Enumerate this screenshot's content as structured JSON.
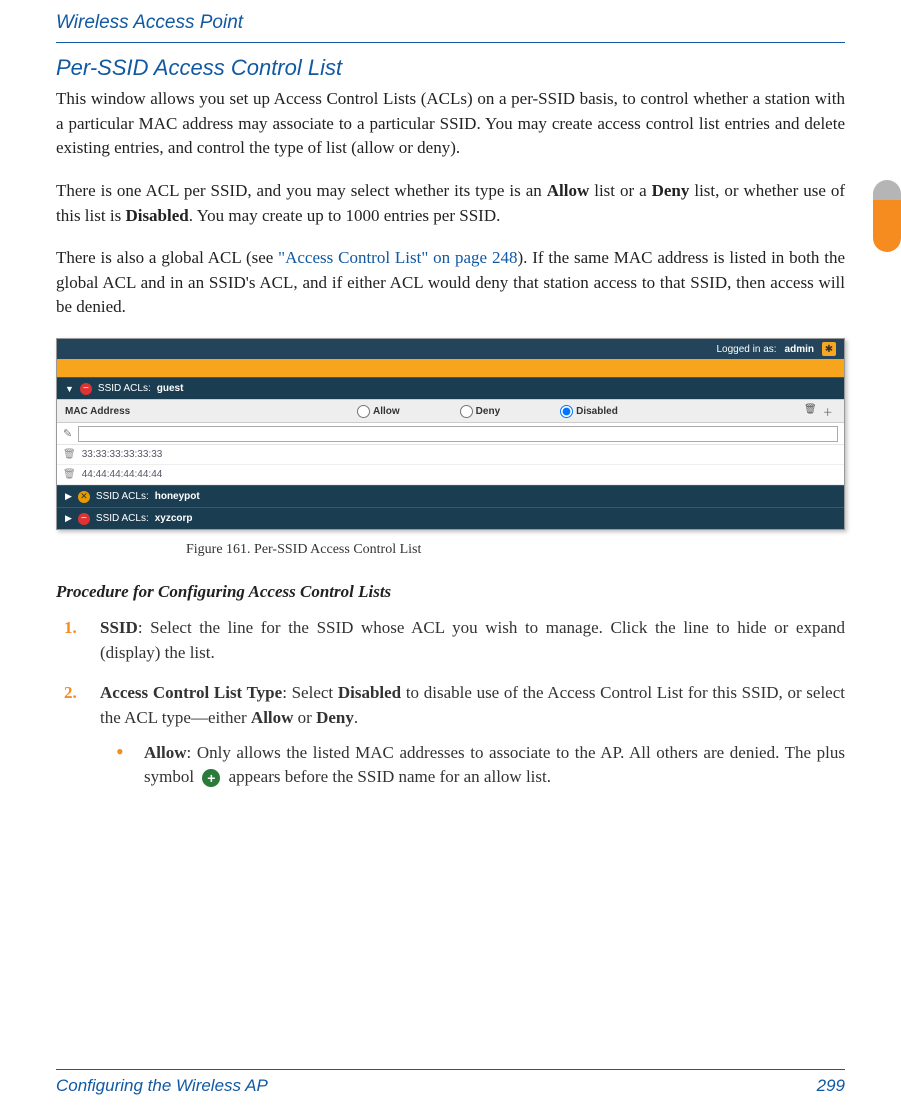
{
  "header": {
    "title": "Wireless Access Point"
  },
  "section": {
    "title": "Per-SSID Access Control List",
    "para1_a": "This window allows you set up Access Control Lists (ACLs) on a per-SSID basis, to control whether a station with a particular MAC address may associate to a particular SSID. You may create access control list entries and delete existing entries, and control the type of list (allow or deny).",
    "para2_a": "There is one ACL per SSID, and you may select whether its type is an ",
    "para2_b": "Allow",
    "para2_c": " list or a ",
    "para2_d": "Deny",
    "para2_e": " list, or whether use of this list is ",
    "para2_f": "Disabled",
    "para2_g": ". You may create up to 1000 entries per SSID.",
    "para3_a": "There is also a global ACL (see ",
    "para3_link": "\"Access Control List\" on page 248",
    "para3_b": "). If the same MAC address is listed in both the global ACL and in an SSID's ACL, and if either ACL would deny that station access to that SSID, then access will be denied."
  },
  "ui": {
    "login_prefix": "Logged in as:",
    "login_user": "admin",
    "ssid_label_prefix": "SSID ACLs:",
    "ssid_guest": "guest",
    "ssid_honeypot": "honeypot",
    "ssid_xyzcorp": "xyzcorp",
    "th_mac": "MAC Address",
    "radio_allow": "Allow",
    "radio_deny": "Deny",
    "radio_disabled": "Disabled",
    "mac1": "33:33:33:33:33:33",
    "mac2": "44:44:44:44:44:44"
  },
  "figure_caption": "Figure 161. Per-SSID Access Control List",
  "procedure": {
    "title": "Procedure for Configuring Access Control Lists",
    "step1_bold": "SSID",
    "step1_text": ": Select the line for the SSID whose ACL you wish to manage. Click the line to hide or expand (display) the list.",
    "step2_bold": "Access Control List Type",
    "step2_mid1": ": Select ",
    "step2_bold2": "Disabled",
    "step2_mid2": " to disable use of the Access Control List for this SSID, or select the ACL type—either ",
    "step2_bold3": "Allow",
    "step2_mid3": " or ",
    "step2_bold4": "Deny",
    "step2_end": ".",
    "sub1_bold": "Allow",
    "sub1_a": ": Only allows the listed MAC addresses to associate to the AP. All others are denied. The plus symbol ",
    "sub1_b": " appears before the SSID name for an allow list."
  },
  "footer": {
    "left": "Configuring the Wireless AP",
    "right": "299"
  }
}
